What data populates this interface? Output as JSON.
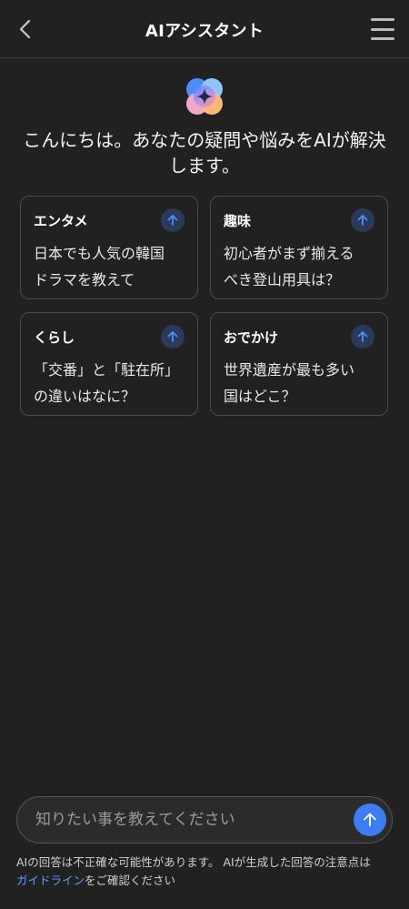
{
  "header": {
    "title": "AIアシスタント",
    "back_icon": "chevron-left-icon",
    "menu_icon": "hamburger-menu-icon"
  },
  "hero": {
    "logo_icon": "ai-sparkle-logo-icon",
    "greeting_line1": "こんにちは。あなたの疑問や悩みをAIが解決",
    "greeting_line2": "します。"
  },
  "suggestions": [
    {
      "category": "エンタメ",
      "line1": "日本でも人気の韓国",
      "line2": "ドラマを教えて"
    },
    {
      "category": "趣味",
      "line1": "初心者がまず揃える",
      "line2": "べき登山用具は？"
    },
    {
      "category": "くらし",
      "line1": "「交番」と「駐在所」",
      "line2": "の違いはなに？"
    },
    {
      "category": "おでかけ",
      "line1": "世界遺産が最も多い",
      "line2": "国はどこ？"
    }
  ],
  "input": {
    "placeholder": "知りたい事を教えてください",
    "value": ""
  },
  "footer": {
    "line1": "AIの回答は不正確な可能性があります。 AIが生成した回答の注意点は",
    "link": "ガイドライン",
    "line2_rest": "をご確認ください"
  },
  "colors": {
    "background": "#212121",
    "accent": "#3d7df2",
    "link": "#5b9bff",
    "card_border": "#4a4a4a"
  }
}
